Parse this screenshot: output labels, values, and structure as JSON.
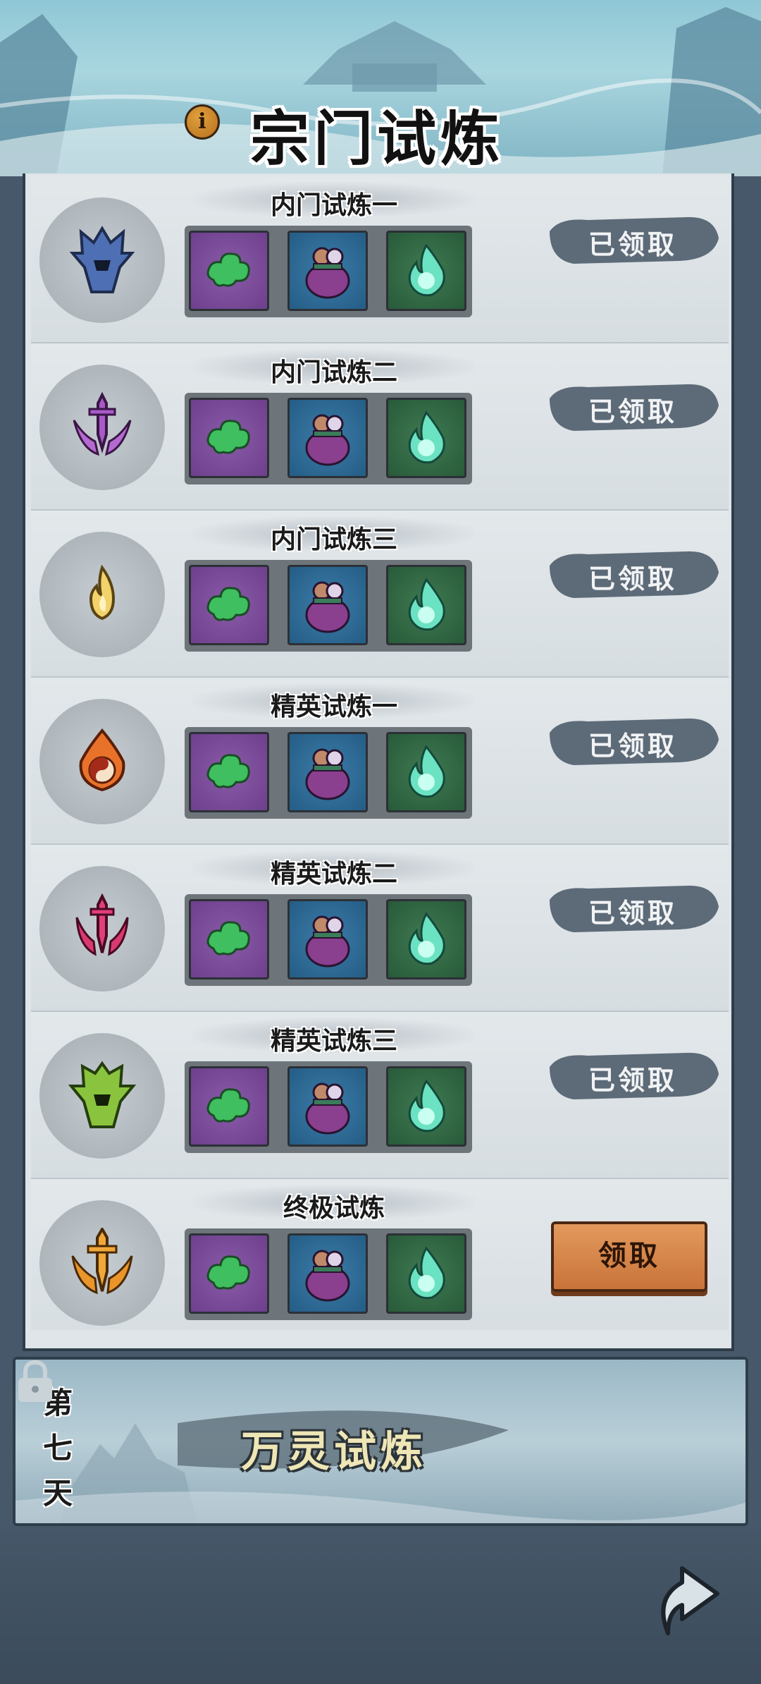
{
  "header": {
    "title": "宗门试炼",
    "info_icon": "i"
  },
  "trials": [
    {
      "title": "内门试炼一",
      "emblem": "blue-helmet-icon",
      "status": "已领取"
    },
    {
      "title": "内门试炼二",
      "emblem": "purple-sword-icon",
      "status": "已领取"
    },
    {
      "title": "内门试炼三",
      "emblem": "yellow-flame-icon",
      "status": "已领取"
    },
    {
      "title": "精英试炼一",
      "emblem": "fire-yinyang-icon",
      "status": "已领取"
    },
    {
      "title": "精英试炼二",
      "emblem": "pink-sword-icon",
      "status": "已领取"
    },
    {
      "title": "精英试炼三",
      "emblem": "green-helmet-icon",
      "status": "已领取"
    },
    {
      "title": "终极试炼",
      "emblem": "gold-sword-icon",
      "status": "领取"
    }
  ],
  "rewards": [
    "jade-cloud-icon",
    "treasure-bag-icon",
    "spirit-flame-icon"
  ],
  "day_banner": {
    "day_label": [
      "第",
      "七",
      "天"
    ],
    "title": "万灵试炼",
    "locked": true
  },
  "colors": {
    "claimed_bg": "#5d6a78",
    "claim_button": "#d9874a",
    "panel_bg": "#dfe5e8"
  }
}
